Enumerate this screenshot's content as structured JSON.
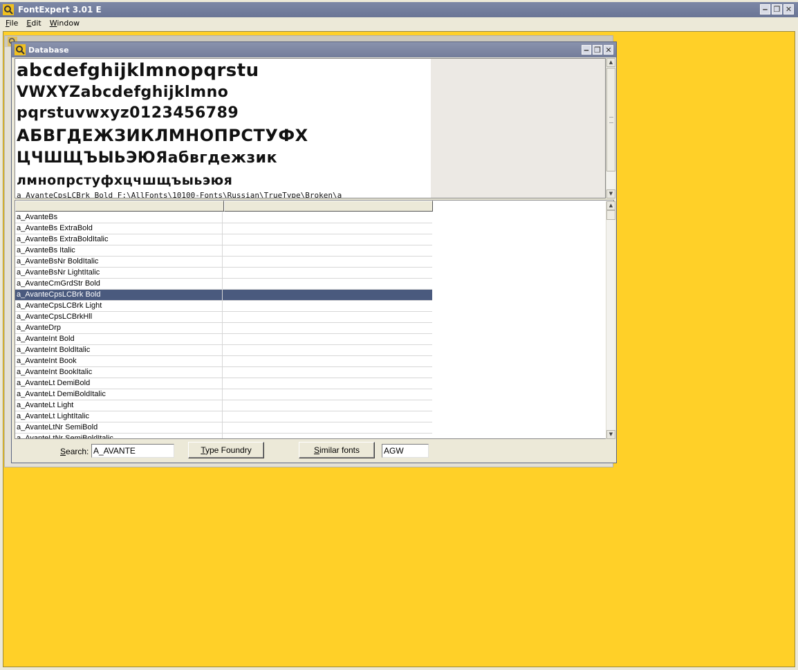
{
  "app": {
    "title": "FontExpert 3.01 E",
    "window_buttons": [
      "minimize",
      "restore",
      "close"
    ]
  },
  "menu": {
    "items": [
      {
        "label": "File"
      },
      {
        "label": "Edit"
      },
      {
        "label": "Window"
      }
    ]
  },
  "database_window": {
    "title": "Database",
    "preview": {
      "lines": [
        "abcdefghijklmnopqrstu",
        "VWXYZabcdefghijklmno",
        "pqrstuvwxyz0123456789",
        "АБВГДЕЖЗИКЛМНОПРСТУФХ",
        "ЦЧШЩЪЫЬЭЮЯабвгдежзик",
        "лмнопрстуфхцчшщъыьэюя"
      ],
      "path_text": "a_AvanteCpsLCBrk Bold    F:\\AllFonts\\10100-Fonts\\Russian\\TrueType\\Broken\\a"
    },
    "list": {
      "columns": [
        "",
        ""
      ],
      "rows": [
        {
          "name": "a_AvanteBs",
          "selected": false
        },
        {
          "name": "a_AvanteBs ExtraBold",
          "selected": false
        },
        {
          "name": "a_AvanteBs ExtraBoldItalic",
          "selected": false
        },
        {
          "name": "a_AvanteBs Italic",
          "selected": false
        },
        {
          "name": "a_AvanteBsNr BoldItalic",
          "selected": false
        },
        {
          "name": "a_AvanteBsNr LightItalic",
          "selected": false
        },
        {
          "name": "a_AvanteCmGrdStr Bold",
          "selected": false
        },
        {
          "name": "a_AvanteCpsLCBrk Bold",
          "selected": true
        },
        {
          "name": "a_AvanteCpsLCBrk Light",
          "selected": false
        },
        {
          "name": "a_AvanteCpsLCBrkHll",
          "selected": false
        },
        {
          "name": "a_AvanteDrp",
          "selected": false
        },
        {
          "name": "a_AvanteInt Bold",
          "selected": false
        },
        {
          "name": "a_AvanteInt BoldItalic",
          "selected": false
        },
        {
          "name": "a_AvanteInt Book",
          "selected": false
        },
        {
          "name": "a_AvanteInt BookItalic",
          "selected": false
        },
        {
          "name": "a_AvanteLt DemiBold",
          "selected": false
        },
        {
          "name": "a_AvanteLt DemiBoldItalic",
          "selected": false
        },
        {
          "name": "a_AvanteLt Light",
          "selected": false
        },
        {
          "name": "a_AvanteLt LightItalic",
          "selected": false
        },
        {
          "name": "a_AvanteLtNr SemiBold",
          "selected": false
        },
        {
          "name": "a_AvanteLtNr SemiBoldItalic",
          "selected": false
        }
      ]
    },
    "search_label": "Search:",
    "search_value": "A_AVANTE",
    "type_foundry_label": "Type Foundry",
    "similar_fonts_label": "Similar fonts",
    "sample_value": "AGW"
  },
  "colors": {
    "workspace": "#ffd028",
    "selection": "#4a5a7e",
    "titlebar": "#6a7595"
  }
}
